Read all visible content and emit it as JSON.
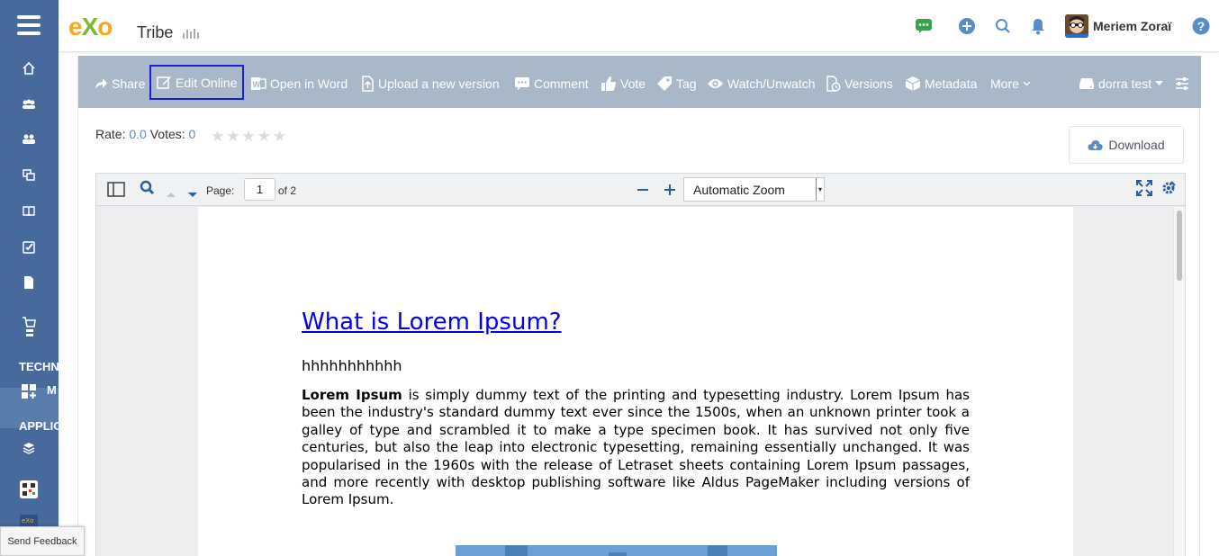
{
  "brand": {
    "logo_e": "e",
    "logo_x": "X",
    "logo_o": "o",
    "space_name": "Tribe"
  },
  "sidebar": {
    "sections": [
      "TECHN",
      "APPLIC"
    ],
    "highlight_label": "M"
  },
  "header": {
    "user_name": "Meriem Zoraï"
  },
  "toolbar": {
    "share": "Share",
    "edit_online": "Edit Online",
    "open_in_word": "Open in Word",
    "upload_new_version": "Upload a new version",
    "comment": "Comment",
    "vote": "Vote",
    "tag": "Tag",
    "watch": "Watch/Unwatch",
    "versions": "Versions",
    "metadata": "Metadata",
    "more": "More",
    "drive": "dorra test"
  },
  "rating": {
    "rate_label": "Rate:",
    "rate_value": "0.0",
    "votes_label": "Votes:",
    "votes_value": "0",
    "stars": 5
  },
  "download_label": "Download",
  "viewer": {
    "page_label": "Page:",
    "page_current": "1",
    "page_of": "of 2",
    "zoom": "Automatic Zoom"
  },
  "document": {
    "title": "What is Lorem Ipsum?",
    "subtitle": "hhhhhhhhhhh",
    "para_bold": "Lorem Ipsum",
    "para_rest": " is simply dummy text of the printing and typesetting industry. Lorem Ipsum has been the industry's standard dummy text ever since the 1500s, when an unknown printer took a galley of type and scrambled it to make a type specimen book. It has survived not only five centuries, but also the leap into electronic typesetting, remaining essentially unchanged. It was popularised in the 1960s with the release of Letraset sheets containing Lorem Ipsum passages, and more recently with desktop publishing software like Aldus PageMaker including versions of Lorem Ipsum."
  },
  "feedback_label": "Send Feedback",
  "colors": {
    "sidebar": "#476a9c",
    "toolbar": "#a9b8c9",
    "link": "#578dc9",
    "active_border": "#1d1dd8"
  }
}
